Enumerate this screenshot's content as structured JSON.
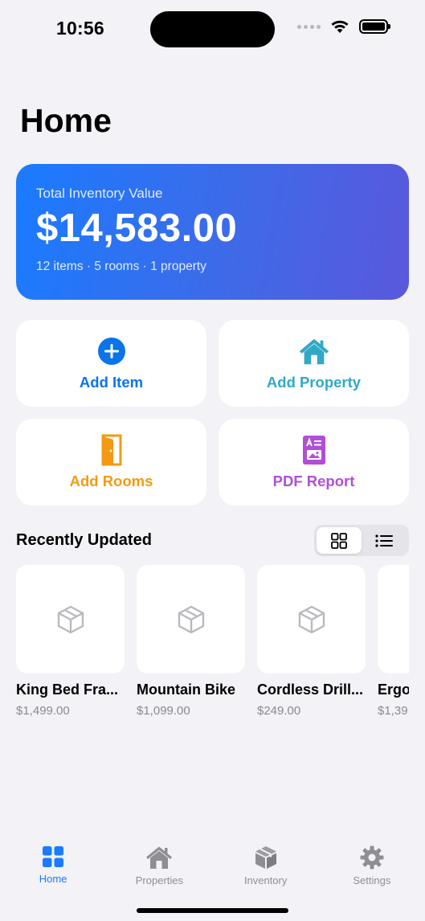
{
  "status_bar": {
    "time": "10:56"
  },
  "page_title": "Home",
  "summary": {
    "label": "Total Inventory Value",
    "amount": "$14,583.00",
    "meta": "12 items · 5 rooms · 1 property"
  },
  "actions": [
    {
      "label": "Add Item",
      "icon": "plus-circle-icon",
      "color": "#0a74e8"
    },
    {
      "label": "Add Property",
      "icon": "house-icon",
      "color": "#30a9c6"
    },
    {
      "label": "Add Rooms",
      "icon": "door-icon",
      "color": "#f49a12"
    },
    {
      "label": "PDF Report",
      "icon": "report-icon",
      "color": "#b04fd6"
    }
  ],
  "recent": {
    "title": "Recently Updated",
    "view_toggle": {
      "selected": "grid",
      "options": [
        "grid",
        "list"
      ]
    },
    "items": [
      {
        "name": "King Bed Fra...",
        "price": "$1,499.00",
        "icon": "box-icon"
      },
      {
        "name": "Mountain Bike",
        "price": "$1,099.00",
        "icon": "box-icon"
      },
      {
        "name": "Cordless Drill...",
        "price": "$249.00",
        "icon": "box-icon"
      },
      {
        "name": "Ergo",
        "price": "$1,39",
        "icon": "box-icon"
      }
    ]
  },
  "tabs": [
    {
      "label": "Home",
      "icon": "grid-icon",
      "active": true
    },
    {
      "label": "Properties",
      "icon": "house-icon",
      "active": false
    },
    {
      "label": "Inventory",
      "icon": "cube-icon",
      "active": false
    },
    {
      "label": "Settings",
      "icon": "gear-icon",
      "active": false
    }
  ],
  "colors": {
    "accent": "#1a7bff",
    "background": "#f2f2f7",
    "muted": "#8e8e93"
  }
}
